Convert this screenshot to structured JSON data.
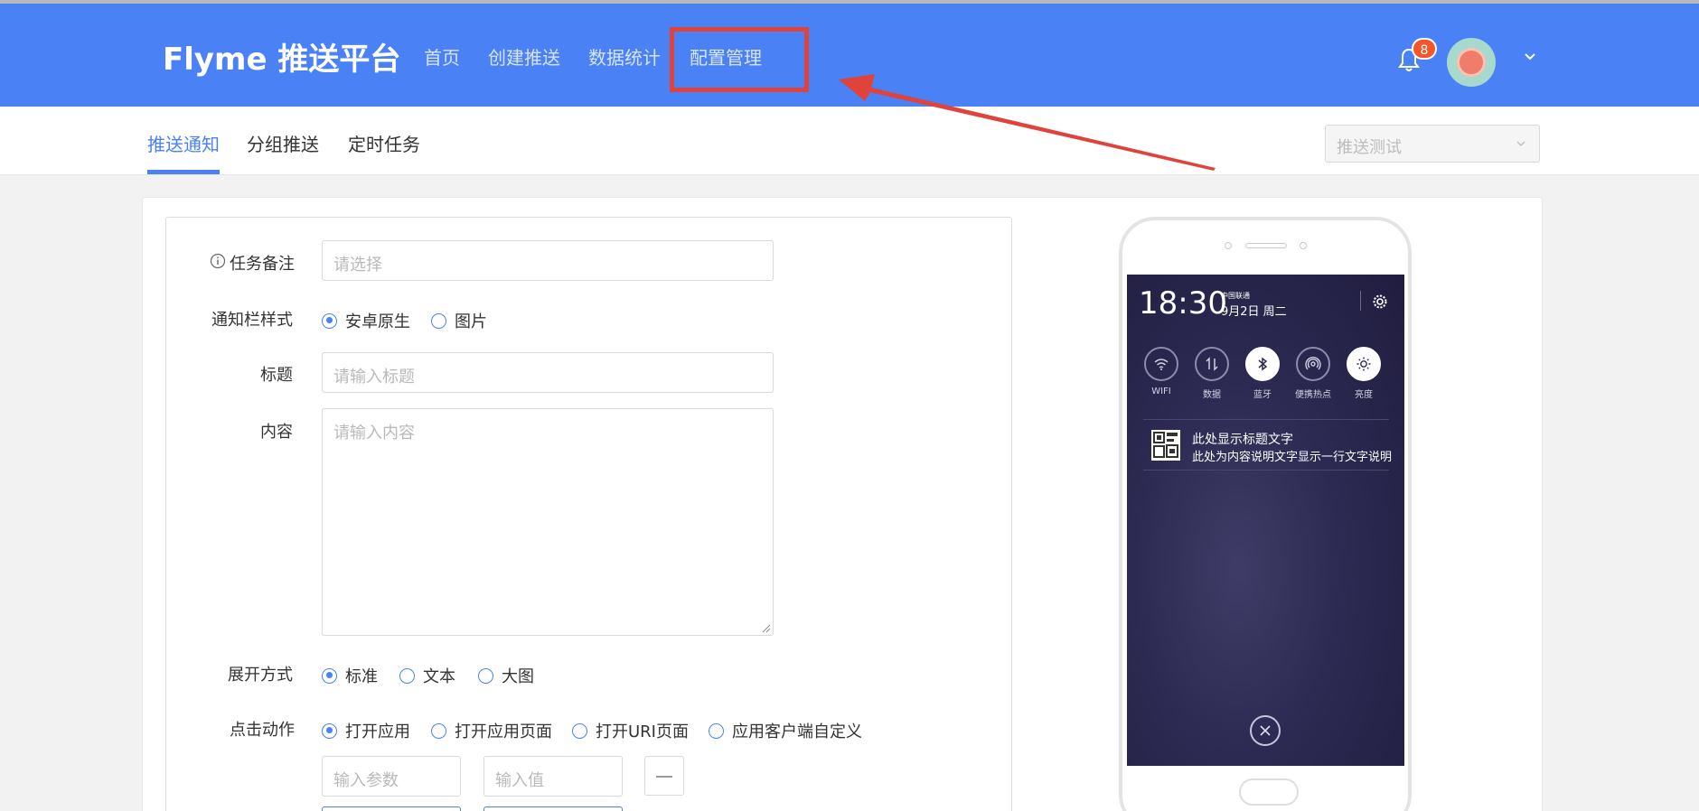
{
  "header": {
    "logo": "Flyme 推送平台",
    "nav": [
      "首页",
      "创建推送",
      "数据统计",
      "配置管理"
    ],
    "notification_count": "8"
  },
  "subnav": {
    "tabs": [
      "推送通知",
      "分组推送",
      "定时任务"
    ],
    "test_select": "推送测试"
  },
  "form": {
    "task_note": {
      "label": "任务备注",
      "placeholder": "请选择"
    },
    "notify_style": {
      "label": "通知栏样式",
      "options": [
        "安卓原生",
        "图片"
      ],
      "selected": "安卓原生"
    },
    "title": {
      "label": "标题",
      "placeholder": "请输入标题"
    },
    "content": {
      "label": "内容",
      "placeholder": "请输入内容"
    },
    "expand_mode": {
      "label": "展开方式",
      "options": [
        "标准",
        "文本",
        "大图"
      ],
      "selected": "标准"
    },
    "click_action": {
      "label": "点击动作",
      "options": [
        "打开应用",
        "打开应用页面",
        "打开URI页面",
        "应用客户端自定义"
      ],
      "selected": "打开应用"
    },
    "param_placeholder": "输入参数",
    "value_placeholder": "输入值"
  },
  "preview": {
    "time": "18:30",
    "carrier": "中国联通",
    "date": "9月2日 周二",
    "quick_settings": [
      "WIFI",
      "数据",
      "蓝牙",
      "便携热点",
      "亮度"
    ],
    "notif_title": "此处显示标题文字",
    "notif_body": "此处为内容说明文字显示一行文字说明"
  },
  "colors": {
    "brand": "#4a81f5",
    "highlight": "#e0433b",
    "badge": "#f2562a"
  }
}
